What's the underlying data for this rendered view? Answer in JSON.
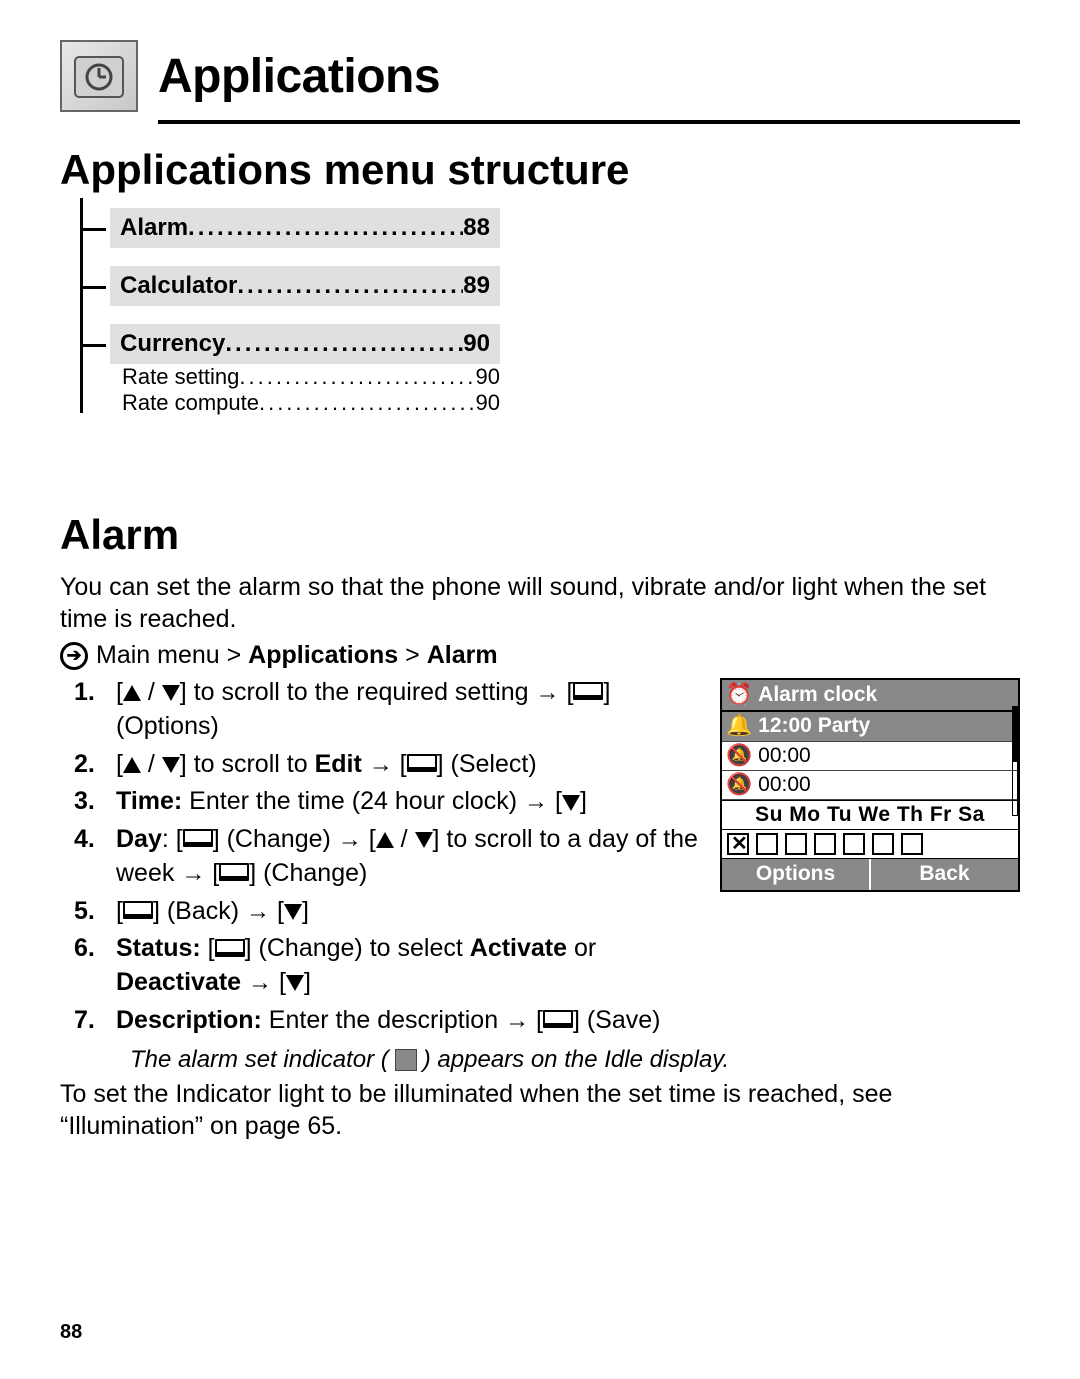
{
  "chapter": {
    "title": "Applications"
  },
  "section1": {
    "title": "Applications menu structure"
  },
  "menu": {
    "items": [
      {
        "label": "Alarm",
        "page": "88"
      },
      {
        "label": "Calculator",
        "page": "89"
      },
      {
        "label": "Currency",
        "page": "90",
        "sub": [
          {
            "label": "Rate setting",
            "page": "90"
          },
          {
            "label": "Rate compute",
            "page": "90"
          }
        ]
      }
    ]
  },
  "section2": {
    "title": "Alarm"
  },
  "intro": "You can set the alarm so that the phone will sound, vibrate and/or light when the set time is reached.",
  "nav": {
    "prefix": "Main menu > ",
    "mid": "Applications",
    "sep": " > ",
    "end": "Alarm"
  },
  "steps": {
    "s1a": "] to scroll to the required setting ",
    "s1b": "] (Options)",
    "s2a": "] to scroll to ",
    "s2edit": "Edit",
    "s2b": "] (Select)",
    "s3lead": "Time:",
    "s3a": " Enter the time (24 hour clock) ",
    "s4lead": "Day",
    "s4a": "] (Change) ",
    "s4b": "] to scroll to a day of the week ",
    "s4c": "] (Change)",
    "s5a": "] (Back) ",
    "s6lead": "Status:",
    "s6a": "] (Change) to select ",
    "s6act": "Activate",
    "s6or": " or ",
    "s6de": "Deactivate",
    "s7lead": "Description:",
    "s7a": " Enter the description ",
    "s7b": "] (Save)"
  },
  "note": {
    "a": "The alarm set indicator (",
    "b": ") appears on the Idle display."
  },
  "outro": "To set the Indicator light to be illuminated when the set time is reached, see “Illumination” on page 65.",
  "phone": {
    "title": "Alarm clock",
    "row1": "12:00 Party",
    "row2": "00:00",
    "row3": "00:00",
    "days": "Su Mo Tu We Th Fr Sa",
    "left": "Options",
    "right": "Back"
  },
  "pageNumber": "88"
}
